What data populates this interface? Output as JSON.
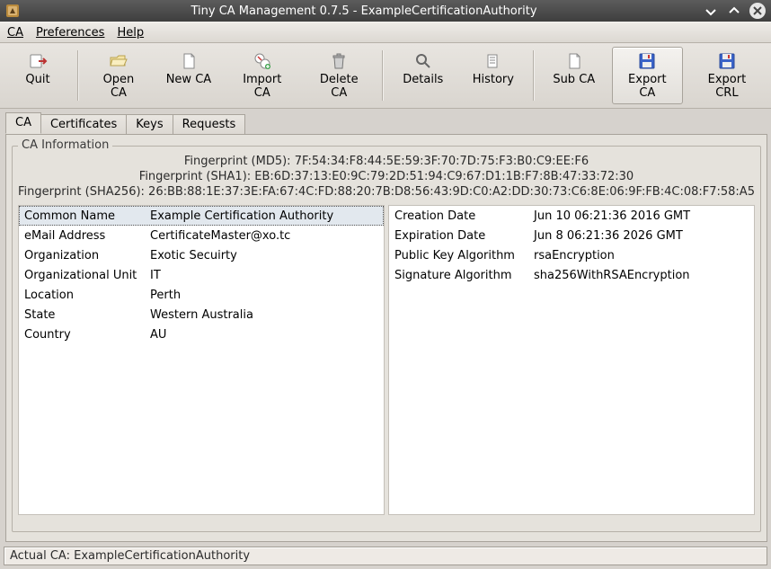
{
  "window": {
    "title": "Tiny CA Management 0.7.5 - ExampleCertificationAuthority"
  },
  "menu": {
    "ca": "CA",
    "preferences": "Preferences",
    "help": "Help"
  },
  "toolbar": {
    "quit": "Quit",
    "open_ca": "Open CA",
    "new_ca": "New CA",
    "import_ca": "Import CA",
    "delete_ca": "Delete CA",
    "details": "Details",
    "history": "History",
    "sub_ca": "Sub CA",
    "export_ca": "Export CA",
    "export_crl": "Export CRL"
  },
  "tabs": {
    "ca": "CA",
    "certificates": "Certificates",
    "keys": "Keys",
    "requests": "Requests"
  },
  "group": {
    "legend": "CA Information"
  },
  "fingerprints": {
    "md5": "Fingerprint (MD5): 7F:54:34:F8:44:5E:59:3F:70:7D:75:F3:B0:C9:EE:F6",
    "sha1": "Fingerprint (SHA1): EB:6D:37:13:E0:9C:79:2D:51:94:C9:67:D1:1B:F7:8B:47:33:72:30",
    "sha256": "Fingerprint (SHA256): 26:BB:88:1E:37:3E:FA:67:4C:FD:88:20:7B:D8:56:43:9D:C0:A2:DD:30:73:C6:8E:06:9F:FB:4C:08:F7:58:A5"
  },
  "left": {
    "common_name_k": "Common Name",
    "common_name_v": "Example Certification Authority",
    "email_k": "eMail Address",
    "email_v": "CertificateMaster@xo.tc",
    "org_k": "Organization",
    "org_v": "Exotic Secuirty",
    "ou_k": "Organizational Unit",
    "ou_v": "IT",
    "loc_k": "Location",
    "loc_v": "Perth",
    "state_k": "State",
    "state_v": "Western Australia",
    "country_k": "Country",
    "country_v": "AU"
  },
  "right": {
    "created_k": "Creation Date",
    "created_v": "Jun 10 06:21:36 2016 GMT",
    "expires_k": "Expiration Date",
    "expires_v": "Jun  8 06:21:36 2026 GMT",
    "pka_k": "Public Key Algorithm",
    "pka_v": "rsaEncryption",
    "sa_k": "Signature Algorithm",
    "sa_v": "sha256WithRSAEncryption"
  },
  "status": {
    "text": "Actual CA: ExampleCertificationAuthority"
  }
}
